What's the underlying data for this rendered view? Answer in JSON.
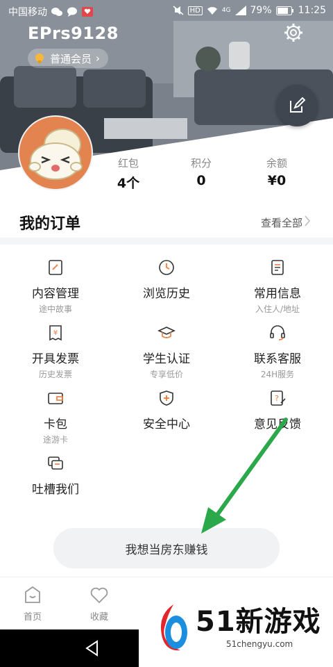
{
  "status": {
    "carrier": "中国移动",
    "battery": "79%",
    "time": "11:25",
    "network": "HD",
    "signal_label": "4G"
  },
  "profile": {
    "username": "EPrs9128",
    "member_label": "普通会员",
    "member_chevron": "›"
  },
  "stats": [
    {
      "label": "红包",
      "value": "4个"
    },
    {
      "label": "积分",
      "value": "0"
    },
    {
      "label": "余额",
      "value": "¥0"
    }
  ],
  "orders": {
    "title": "我的订单",
    "view_all": "查看全部"
  },
  "services": [
    {
      "title": "内容管理",
      "sub": "途中故事",
      "icon": "content-manage-icon"
    },
    {
      "title": "浏览历史",
      "sub": "",
      "icon": "clock-icon"
    },
    {
      "title": "常用信息",
      "sub": "入住人/地址",
      "icon": "info-book-icon"
    },
    {
      "title": "开具发票",
      "sub": "历史发票",
      "icon": "invoice-icon"
    },
    {
      "title": "学生认证",
      "sub": "专享低价",
      "icon": "graduation-cap-icon"
    },
    {
      "title": "联系客服",
      "sub": "24H服务",
      "icon": "headset-icon"
    },
    {
      "title": "卡包",
      "sub": "途游卡",
      "icon": "wallet-icon"
    },
    {
      "title": "安全中心",
      "sub": "",
      "icon": "shield-icon"
    },
    {
      "title": "意见反馈",
      "sub": "",
      "icon": "feedback-icon"
    },
    {
      "title": "吐槽我们",
      "sub": "",
      "icon": "chat-icon"
    }
  ],
  "landlord_button": "我想当房东赚钱",
  "tabs": [
    {
      "label": "首页",
      "icon": "home-icon"
    },
    {
      "label": "收藏",
      "icon": "heart-icon"
    }
  ],
  "watermark": {
    "brand": "51新游戏",
    "url": "51chengyu.com"
  },
  "colors": {
    "accent": "#f07a3a",
    "arrow": "#2aa84a",
    "avatar_bg": "#e3834f"
  }
}
